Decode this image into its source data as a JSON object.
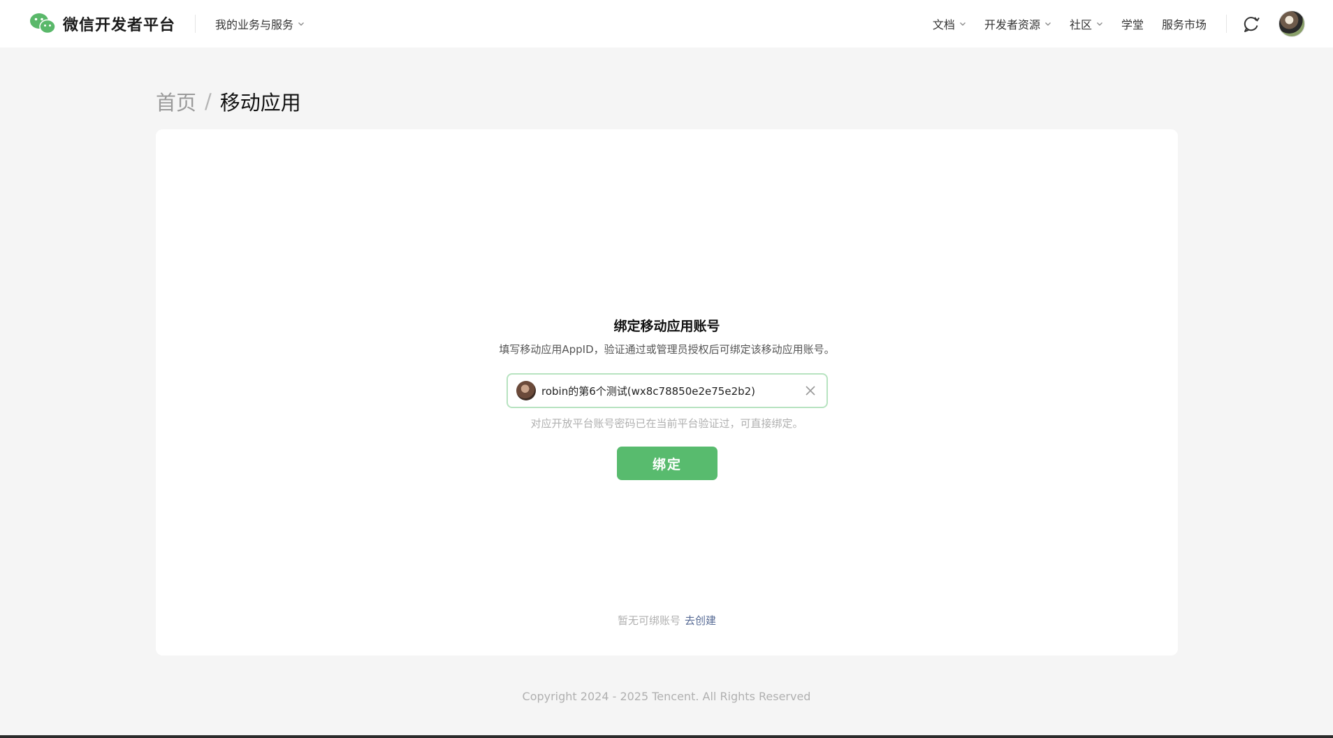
{
  "header": {
    "logo_text": "微信开发者平台",
    "services_menu": "我的业务与服务",
    "nav": {
      "docs": "文档",
      "dev_resources": "开发者资源",
      "community": "社区",
      "academy": "学堂",
      "market": "服务市场"
    }
  },
  "breadcrumb": {
    "home": "首页",
    "separator": "/",
    "current": "移动应用"
  },
  "bind_panel": {
    "title": "绑定移动应用账号",
    "description": "填写移动应用AppID，验证通过或管理员授权后可绑定该移动应用账号。",
    "selected_app": "robin的第6个测试(wx8c78850e2e75e2b2)",
    "hint": "对应开放平台账号密码已在当前平台验证过，可直接绑定。",
    "bind_button": "绑定",
    "no_account_text": "暂无可绑账号",
    "create_link": "去创建"
  },
  "footer": {
    "copyright": "Copyright 2024 - 2025 Tencent. All Rights Reserved"
  },
  "colors": {
    "brand_green": "#58bb6e",
    "link_blue": "#576b95",
    "input_border": "#b7e3c0",
    "page_bg": "#f5f5f5"
  },
  "icons": {
    "logo": "wechat-logo-icon",
    "chevron": "chevron-down-icon",
    "message": "message-refresh-icon",
    "clear": "close-icon"
  }
}
